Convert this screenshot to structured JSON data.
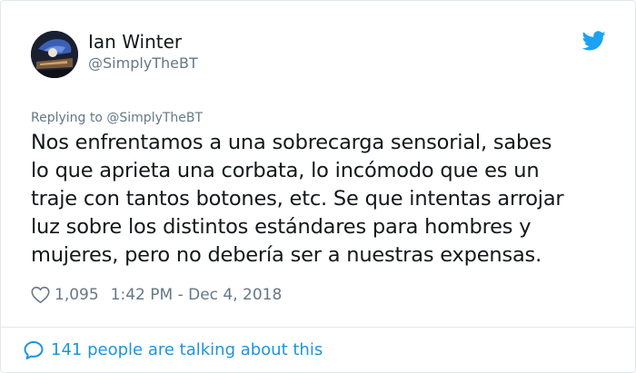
{
  "author": {
    "name": "Ian Winter",
    "handle": "@SimplyTheBT"
  },
  "reply": {
    "prefix": "Replying to ",
    "mention": "@SimplyTheBT"
  },
  "tweet": {
    "lines": [
      "Nos enfrentamos a una sobrecarga sensorial, sabes",
      "lo que aprieta una corbata, lo incómodo que es un",
      "traje con tantos botones, etc. Se que intentas arrojar",
      "luz sobre los distintos estándares para hombres y",
      "mujeres, pero no debería ser a nuestras expensas."
    ]
  },
  "meta": {
    "likes": "1,095",
    "timestamp": "1:42 PM - Dec 4, 2018"
  },
  "footer": {
    "talking": "141 people are talking about this"
  },
  "icons": {
    "brand": "twitter-bird-icon",
    "like": "heart-icon",
    "conversation": "speech-bubble-icon"
  },
  "colors": {
    "twitter_blue": "#1da1f2",
    "link_blue": "#1b95e0",
    "text": "#14171a",
    "secondary_text": "#657786",
    "border": "#e1e8ed"
  }
}
